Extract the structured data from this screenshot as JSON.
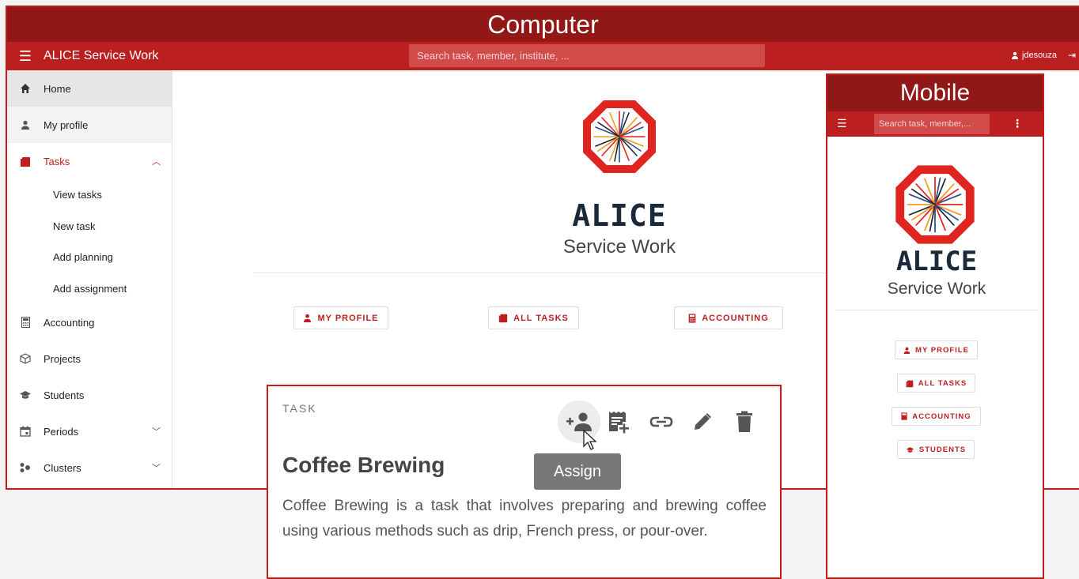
{
  "computer": {
    "frame_label": "Computer",
    "topbar": {
      "app_title": "ALICE Service Work",
      "search_placeholder": "Search task, member, institute, ...",
      "username": "jdesouza"
    },
    "sidebar": {
      "home": "Home",
      "my_profile": "My profile",
      "tasks": "Tasks",
      "tasks_sub": [
        "View tasks",
        "New task",
        "Add planning",
        "Add assignment"
      ],
      "accounting": "Accounting",
      "projects": "Projects",
      "students": "Students",
      "periods": "Periods",
      "clusters": "Clusters"
    },
    "main": {
      "logo_text": "ALICE",
      "subtitle": "Service Work",
      "buttons": {
        "my_profile": "MY PROFILE",
        "all_tasks": "ALL TASKS",
        "accounting": "ACCOUNTING"
      }
    }
  },
  "mobile": {
    "frame_label": "Mobile",
    "search_placeholder": "Search task, member,...",
    "logo_text": "ALICE",
    "subtitle": "Service Work",
    "buttons": {
      "my_profile": "MY PROFILE",
      "all_tasks": "ALL TASKS",
      "accounting": "ACCOUNTING",
      "students": "STUDENTS"
    }
  },
  "task_card": {
    "kicker": "TASK",
    "title": "Coffee Brewing",
    "description": "Coffee Brewing is a task that involves preparing and brewing coffee using various methods such as drip, French press, or pour-over.",
    "tooltip": "Assign",
    "actions": [
      "assign-icon",
      "add-planning-icon",
      "link-icon",
      "edit-icon",
      "delete-icon"
    ]
  },
  "colors": {
    "frame_red": "#c21d1d",
    "label_bar": "#921717",
    "topbar": "#bb1f1f",
    "accent": "#bb1f1f"
  }
}
